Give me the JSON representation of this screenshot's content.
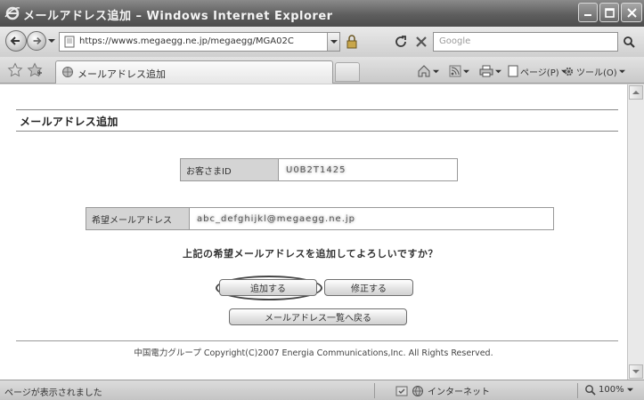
{
  "window": {
    "title": "メールアドレス追加 – Windows Internet Explorer"
  },
  "address_bar": {
    "url": "https://wwws.megaegg.ne.jp/megaegg/MGA02C",
    "search_placeholder": "Google"
  },
  "tab": {
    "label": "メールアドレス追加"
  },
  "command_bar": {
    "page_label": "ページ(P)",
    "tools_label": "ツール(O)"
  },
  "page": {
    "heading": "メールアドレス追加",
    "customer_id_label": "お客さまID",
    "customer_id_value": "U0B2T1425",
    "desired_address_label": "希望メールアドレス",
    "desired_address_value": "abc_defghijkl@megaegg.ne.jp",
    "confirm_question": "上記の希望メールアドレスを追加してよろしいですか？",
    "add_button": "追加する",
    "edit_button": "修正する",
    "back_button": "メールアドレス一覧へ戻る",
    "copyright": "中国電力グループ  Copyright(C)2007 Energia Communications,Inc. All Rights Reserved."
  },
  "status_bar": {
    "status_text": "ページが表示されました",
    "zone_text": "インターネット",
    "zoom_text": "100%"
  },
  "colors": {
    "titlebar": "#5e5e5e",
    "label_cell": "#d4d4d4",
    "content_bg": "#ffffff"
  }
}
